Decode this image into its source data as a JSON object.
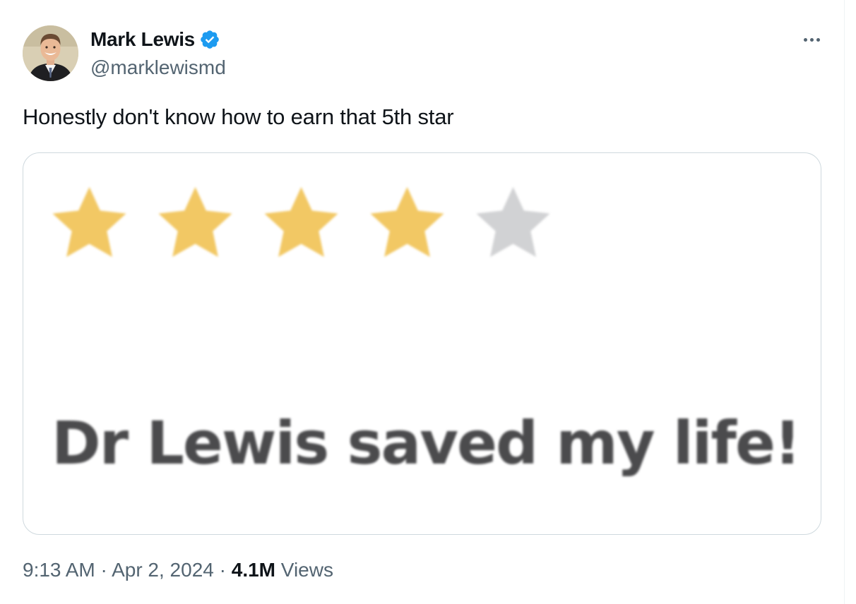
{
  "author": {
    "display_name": "Mark Lewis",
    "handle": "@marklewismd",
    "verified": true,
    "verified_color": "#1d9bf0",
    "avatar_icon": "profile-photo"
  },
  "more_icon": "more-horizontal-icon",
  "tweet": {
    "text": "Honestly don't know how to earn that 5th star"
  },
  "media": {
    "rating": {
      "value": 4,
      "max": 5,
      "filled_color": "#f2c864",
      "empty_color": "#d1d2d4"
    },
    "review_text": "Dr Lewis saved my life!"
  },
  "meta": {
    "time": "9:13 AM",
    "separator": "·",
    "date": "Apr 2, 2024",
    "views_count": "4.1M",
    "views_label": "Views"
  }
}
